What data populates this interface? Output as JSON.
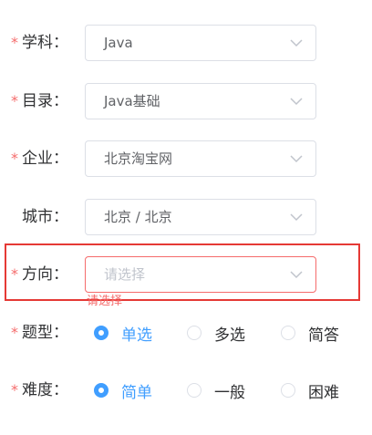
{
  "form": {
    "required_mark": "*",
    "fields": [
      {
        "label": "学科：",
        "value": "Java"
      },
      {
        "label": "目录：",
        "value": "Java基础"
      },
      {
        "label": "企业：",
        "value": "北京淘宝网"
      },
      {
        "label": "城市：",
        "value": "北京 / 北京"
      },
      {
        "label": "方向：",
        "placeholder": "请选择",
        "error": "请选择"
      }
    ],
    "question_type": {
      "label": "题型：",
      "options": [
        "单选",
        "多选",
        "简答"
      ],
      "selected": "单选"
    },
    "difficulty": {
      "label": "难度：",
      "options": [
        "简单",
        "一般",
        "困难"
      ],
      "selected": "简单"
    }
  },
  "colors": {
    "accent": "#409eff",
    "required": "#f56c6c",
    "error_highlight": "#e53935",
    "border": "#dcdfe6",
    "placeholder": "#c0c4cc"
  },
  "icons": {
    "select_arrow": "chevron-down-icon"
  }
}
